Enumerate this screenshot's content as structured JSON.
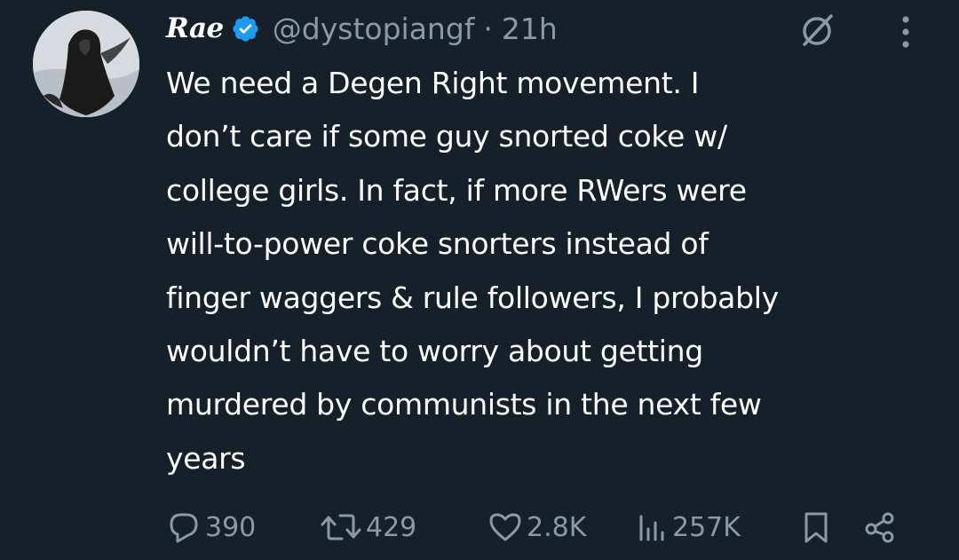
{
  "author": {
    "display_name": "Rae",
    "handle": "@dystopiangf",
    "separator": "·",
    "time": "21h",
    "verified": true,
    "verified_color": "#1d9bf0"
  },
  "tweet": {
    "lines": [
      "We need a Degen Right movement. I",
      "don’t care if some guy snorted coke w/",
      "college girls. In fact, if more RWers were",
      "will-to-power coke snorters instead of",
      "finger waggers & rule followers, I probably",
      "wouldn’t have to worry about getting",
      "murdered by communists in the next few",
      "years"
    ]
  },
  "actions": {
    "replies": "390",
    "reposts": "429",
    "likes": "2.8K",
    "views": "257K"
  },
  "icons": {
    "grok": "grok-icon",
    "more": "more-icon",
    "reply": "reply-icon",
    "repost": "repost-icon",
    "like": "heart-icon",
    "views": "views-icon",
    "bookmark": "bookmark-icon",
    "share": "share-icon"
  },
  "colors": {
    "background": "#15202b",
    "text": "#ffffff",
    "muted": "#8b98a5",
    "accent": "#1d9bf0"
  }
}
